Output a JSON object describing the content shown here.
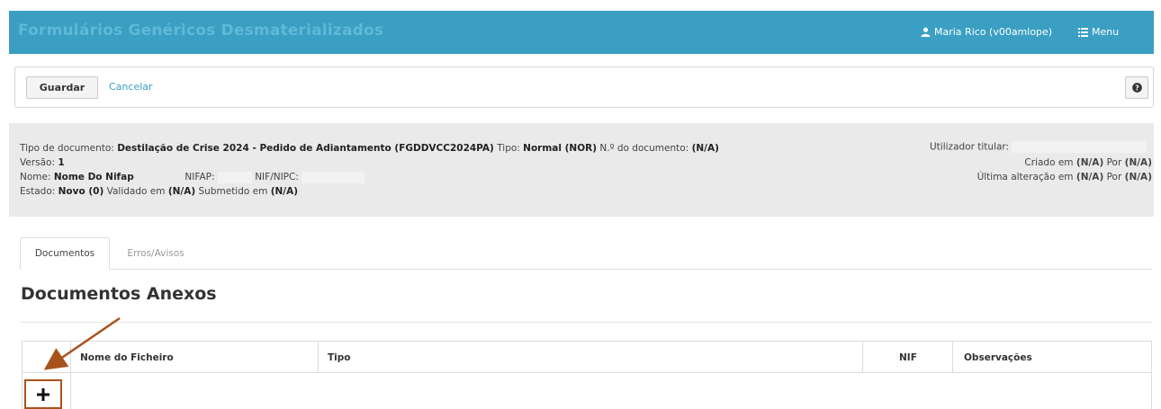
{
  "header": {
    "app_title": "Formulários Genéricos Desmaterializados",
    "user": "Maria Rico (v00amlope)",
    "user_icon": "user-icon",
    "menu_label": "Menu",
    "menu_icon": "list-icon",
    "bar_color": "#3a9fc2"
  },
  "toolbar": {
    "save_label": "Guardar",
    "cancel_label": "Cancelar",
    "help_icon": "question-circle-icon"
  },
  "info": {
    "tipo_documento_label": "Tipo de documento:",
    "tipo_documento_value": "Destilação de Crise 2024 - Pedido de Adiantamento (FGDDVCC2024PA)",
    "tipo_label": "Tipo:",
    "tipo_value": "Normal (NOR)",
    "numero_label": "N.º do documento:",
    "numero_value": "(N/A)",
    "versao_label": "Versão:",
    "versao_value": "1",
    "nome_label": "Nome:",
    "nome_value": "Nome Do Nifap",
    "nifap_label": "NIFAP:",
    "nifnipc_label": "NIF/NIPC:",
    "estado_label": "Estado:",
    "estado_value": "Novo (0)",
    "validado_label": "Validado em",
    "validado_value": "(N/A)",
    "submetido_label": "Submetido em",
    "submetido_value": "(N/A)",
    "utilizador_label": "Utilizador titular:",
    "criado_label": "Criado em",
    "criado_value": "(N/A)",
    "criado_por_label": "Por",
    "criado_por_value": "(N/A)",
    "alteracao_label": "Última alteração em",
    "alteracao_value": "(N/A)",
    "alteracao_por_label": "Por",
    "alteracao_por_value": "(N/A)"
  },
  "tabs": [
    {
      "label": "Documentos",
      "active": true
    },
    {
      "label": "Erros/Avisos",
      "active": false
    }
  ],
  "section": {
    "title": "Documentos Anexos"
  },
  "table": {
    "columns": [
      "",
      "Nome do Ficheiro",
      "Tipo",
      "NIF",
      "Observações"
    ],
    "add_icon": "plus-icon",
    "highlight_color": "#a8531c"
  }
}
